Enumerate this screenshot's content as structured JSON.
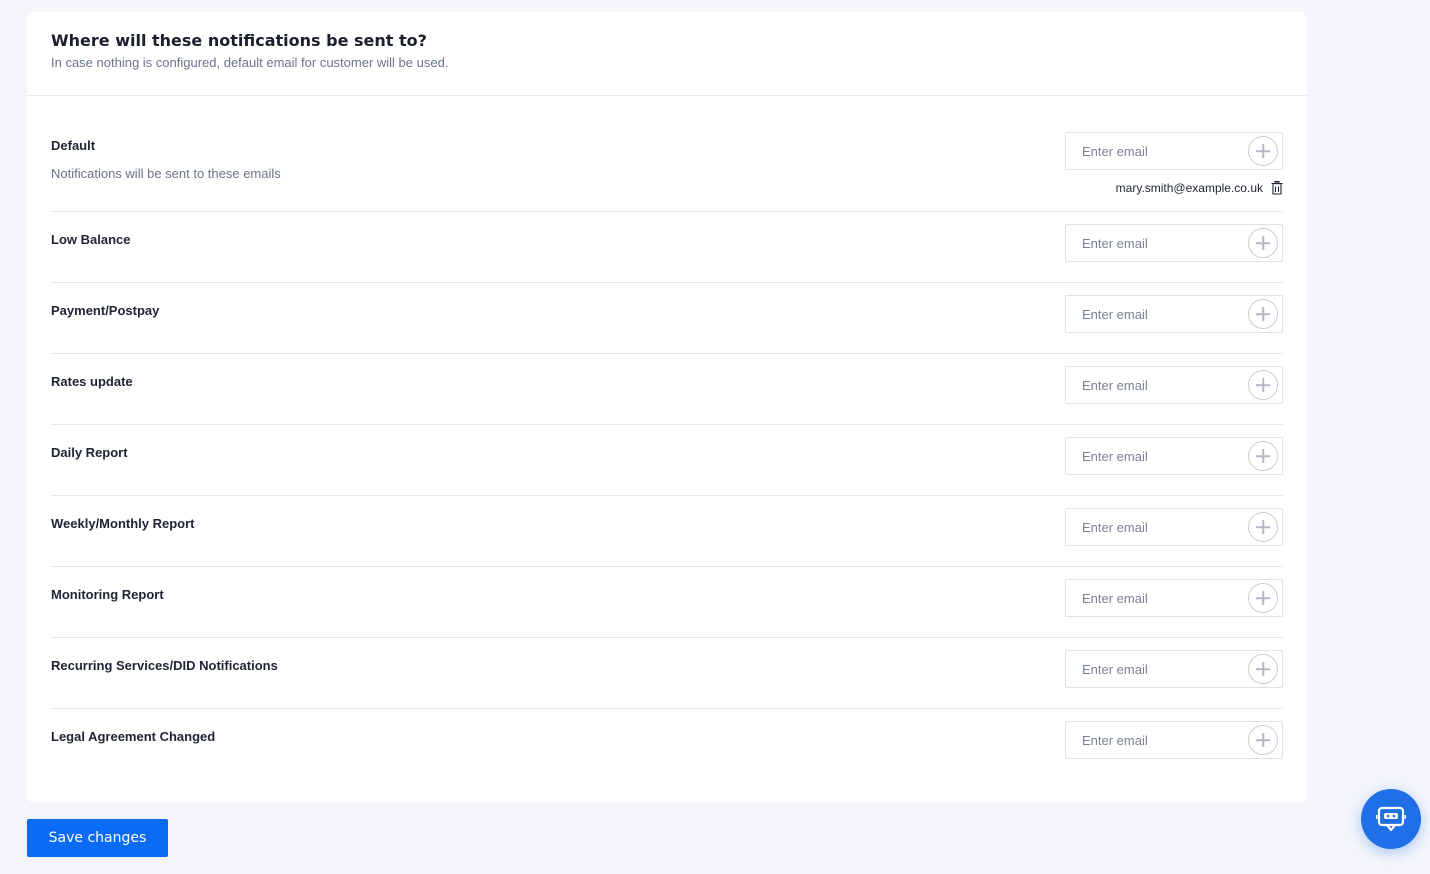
{
  "header": {
    "title": "Where will these notifications be sent to?",
    "subtitle": "In case nothing is configured, default email for customer will be used."
  },
  "email_placeholder": "Enter email",
  "rows": [
    {
      "label": "Default",
      "description": "Notifications will be sent to these emails",
      "emails": [
        "mary.smith@example.co.uk"
      ]
    },
    {
      "label": "Low Balance"
    },
    {
      "label": "Payment/Postpay"
    },
    {
      "label": "Rates update"
    },
    {
      "label": "Daily Report"
    },
    {
      "label": "Weekly/Monthly Report"
    },
    {
      "label": "Monitoring Report"
    },
    {
      "label": "Recurring Services/DID Notifications"
    },
    {
      "label": "Legal Agreement Changed"
    }
  ],
  "save_label": "Save changes",
  "colors": {
    "primary": "#0a6cf5",
    "chat_fab": "#1f6fe8"
  },
  "icons": {
    "add": "plus-circle-icon",
    "delete": "trash-icon",
    "chat": "chat-bot-icon"
  }
}
